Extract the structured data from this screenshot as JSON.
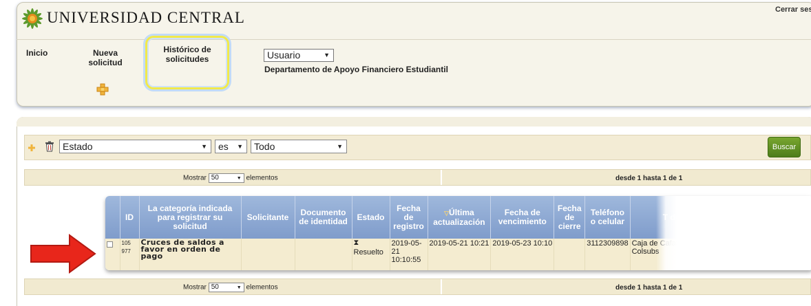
{
  "header": {
    "title": "UNIVERSIDAD CENTRAL",
    "logout": "Cerrar sesión"
  },
  "nav": {
    "inicio": "Inicio",
    "nueva_solicitud": "Nueva solicitud",
    "historico": "Histórico de solicitudes"
  },
  "user": {
    "role_selected": "Usuario",
    "department": "Departamento de Apoyo Financiero Estudiantil"
  },
  "filter": {
    "field": "Estado",
    "operator": "es",
    "value": "Todo",
    "search_label": "Buscar"
  },
  "pager": {
    "show_label": "Mostrar",
    "page_size": "50",
    "items_label": "elementos",
    "range": "desde 1 hasta 1 de 1"
  },
  "table": {
    "headers": [
      "",
      "ID",
      "La categoría indicada para registrar su solicitud",
      "Solicitante",
      "Documento de identidad",
      "Estado",
      "Fecha de registro",
      "Última actualización",
      "Fecha de vencimiento",
      "Fecha de cierre",
      "Teléfono o celular",
      "T de"
    ],
    "rows": [
      {
        "id": "105 977",
        "category": "Cruces de saldos a favor en orden de pago",
        "solicitante": "",
        "documento": "",
        "estado": "Resuelto",
        "fecha_registro": "2019-05-21 10:10:55",
        "ultima_actualizacion": "2019-05-21 10:21",
        "fecha_vencimiento": "2019-05-23 10:10",
        "fecha_cierre": "",
        "telefono": "3112309898",
        "extra": "Caja de Cafam, C Colsubs"
      }
    ]
  },
  "colors": {
    "header_bg": "#f6f4ea",
    "table_header": "#8fabd5",
    "row_bg": "#f4ecd0",
    "search_button": "#5b8a23",
    "highlight_ring": "#f1e94a",
    "annotation_arrow": "#e8261b"
  }
}
